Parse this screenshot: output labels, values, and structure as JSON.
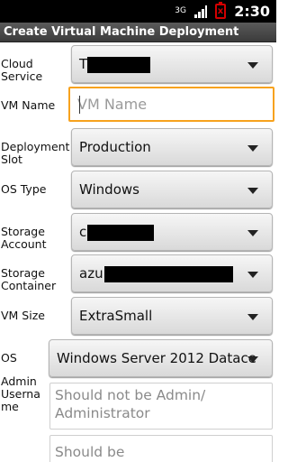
{
  "status_bar": {
    "network": "3G",
    "time": "2:30"
  },
  "header": {
    "title": "Create Virtual Machine Deployment"
  },
  "form": {
    "cloud_service": {
      "label": "Cloud Service",
      "value": "T                    S"
    },
    "vm_name": {
      "label": "VM Name",
      "value": "",
      "placeholder": "VM Name"
    },
    "deployment_slot": {
      "label": "Deployment Slot",
      "value": "Production"
    },
    "os_type": {
      "label": "OS Type",
      "value": "Windows"
    },
    "storage_account": {
      "label": "Storage Account",
      "value": "c                     e"
    },
    "storage_container": {
      "label": "Storage Container",
      "value": "azu                                        nta"
    },
    "vm_size": {
      "label": "VM Size",
      "value": "ExtraSmall"
    },
    "os": {
      "label": "OS",
      "value": "Windows Server 2012 Datace"
    },
    "admin_username": {
      "label": "Admin Userna me",
      "value": "",
      "placeholder": "Should not be Admin/ Administrator"
    },
    "admin_password": {
      "label": "",
      "value": "",
      "placeholder": "Should be"
    }
  },
  "colors": {
    "status_bar": "#000000",
    "title_bar": "#4a4a4a",
    "focus_border": "#f7a21e",
    "battery_alert": "#d40000"
  }
}
